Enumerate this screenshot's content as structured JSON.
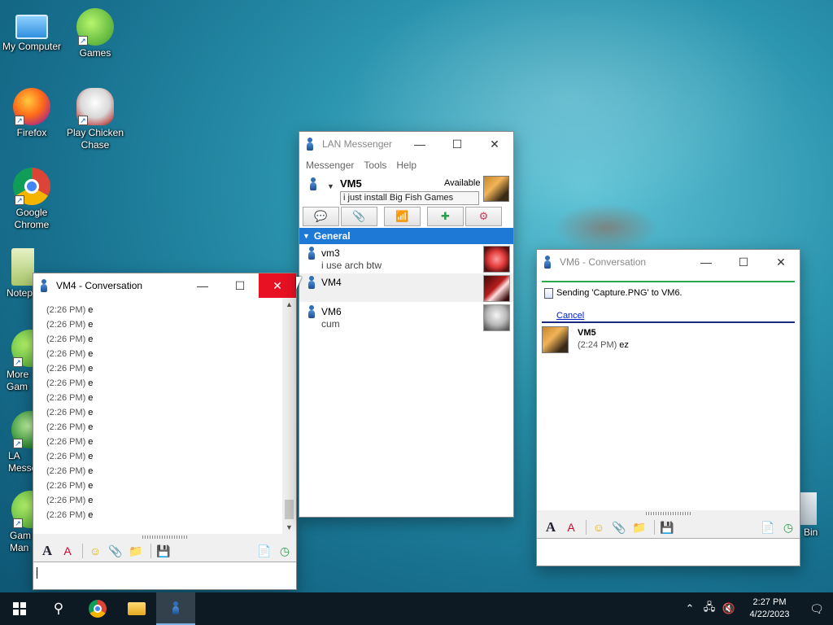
{
  "desktop": {
    "icons": [
      {
        "label": "My Computer"
      },
      {
        "label": "Games"
      },
      {
        "label": "Firefox"
      },
      {
        "label": "Play Chicken Chase"
      },
      {
        "label": "Google Chrome"
      },
      {
        "label": "Notep"
      },
      {
        "label": "More Gam"
      },
      {
        "label": "LA Messe"
      },
      {
        "label": "Gam Man"
      },
      {
        "label": "Bin"
      }
    ]
  },
  "conv_vm4": {
    "title": "VM4 - Conversation",
    "messages": [
      {
        "time": "(2:26 PM)",
        "text": "e"
      },
      {
        "time": "(2:26 PM)",
        "text": "e"
      },
      {
        "time": "(2:26 PM)",
        "text": "e"
      },
      {
        "time": "(2:26 PM)",
        "text": "e"
      },
      {
        "time": "(2:26 PM)",
        "text": "e"
      },
      {
        "time": "(2:26 PM)",
        "text": "e"
      },
      {
        "time": "(2:26 PM)",
        "text": "e"
      },
      {
        "time": "(2:26 PM)",
        "text": "e"
      },
      {
        "time": "(2:26 PM)",
        "text": "e"
      },
      {
        "time": "(2:26 PM)",
        "text": "e"
      },
      {
        "time": "(2:26 PM)",
        "text": "e"
      },
      {
        "time": "(2:26 PM)",
        "text": "e"
      },
      {
        "time": "(2:26 PM)",
        "text": "e"
      },
      {
        "time": "(2:26 PM)",
        "text": "e"
      },
      {
        "time": "(2:26 PM)",
        "text": "e"
      }
    ],
    "input_value": ""
  },
  "lan_messenger": {
    "title": "LAN Messenger",
    "menu": [
      "Messenger",
      "Tools",
      "Help"
    ],
    "user": {
      "name": "VM5",
      "status": "Available",
      "note": "i just install Big Fish Games"
    },
    "group": "General",
    "contacts": [
      {
        "name": "vm3",
        "note": "i use arch btw"
      },
      {
        "name": "VM4",
        "note": ""
      },
      {
        "name": "VM6",
        "note": "cum"
      }
    ]
  },
  "conv_vm6": {
    "title": "VM6 - Conversation",
    "transfer_text": "Sending 'Capture.PNG' to VM6.",
    "cancel_label": "Cancel",
    "message": {
      "sender": "VM5",
      "time": "(2:24 PM)",
      "text": "ez"
    }
  },
  "taskbar": {
    "time": "2:27 PM",
    "date": "4/22/2023"
  },
  "colors": {
    "accent": "#1e78d6",
    "close_red": "#e81123",
    "taskbar": "#0d1a24"
  }
}
